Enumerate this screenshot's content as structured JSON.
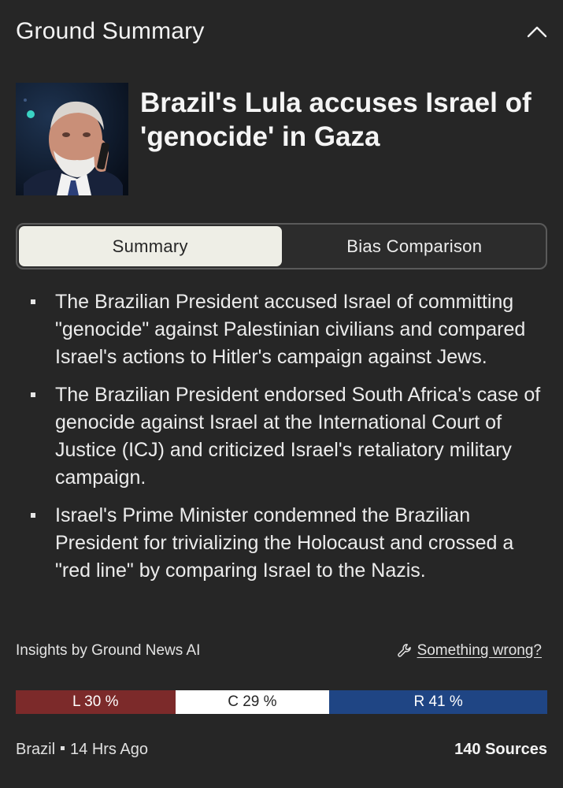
{
  "header": {
    "title": "Ground Summary",
    "collapse_icon": "chevron-up-icon"
  },
  "story": {
    "headline": "Brazil's Lula accuses Israel of 'genocide' in Gaza",
    "thumbnail_icon": "person-on-phone-photo"
  },
  "tabs": [
    {
      "label": "Summary",
      "active": true
    },
    {
      "label": "Bias Comparison",
      "active": false
    }
  ],
  "summary": {
    "bullets": [
      "The Brazilian President accused Israel of committing \"genocide\" against Palestinian civilians and compared Israel's actions to Hitler's campaign against Jews.",
      "The Brazilian President endorsed South Africa's case of genocide against Israel at the International Court of Justice (ICJ) and criticized Israel's retaliatory military campaign.",
      "Israel's Prime Minister condemned the Brazilian President for trivializing the Holocaust and crossed a \"red line\" by comparing Israel to the Nazis."
    ]
  },
  "insights": {
    "credit": "Insights by Ground News AI",
    "report_label": "Something wrong?",
    "report_icon": "wrench-icon"
  },
  "bias": {
    "left": {
      "label": "L 30 %",
      "value": 30,
      "color": "#7c2a2a"
    },
    "center": {
      "label": "C 29 %",
      "value": 29,
      "color": "#ffffff"
    },
    "right": {
      "label": "R 41 %",
      "value": 41,
      "color": "#1f4584"
    }
  },
  "footer": {
    "location": "Brazil",
    "time": "14 Hrs Ago",
    "sources": "140 Sources"
  },
  "colors": {
    "background": "#262626",
    "text": "#f2f2f2",
    "tab_active": "#eeeee6"
  }
}
